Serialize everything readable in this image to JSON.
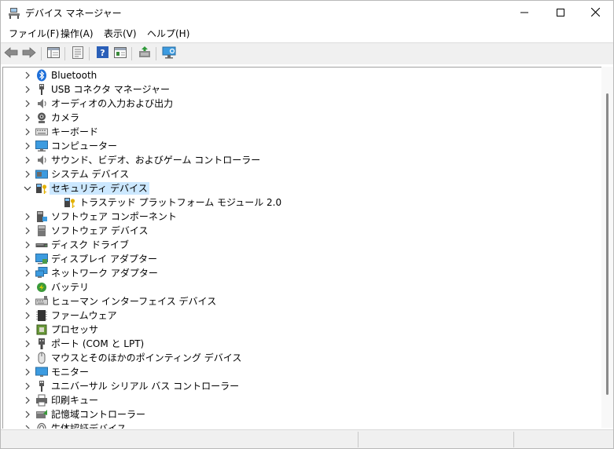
{
  "window": {
    "title": "デバイス マネージャー",
    "icons": {
      "app": "device-manager-icon",
      "minimize": "minimize-icon",
      "maximize": "maximize-icon",
      "close": "close-icon"
    }
  },
  "menu": [
    {
      "label": "ファイル(F)"
    },
    {
      "label": "操作(A)"
    },
    {
      "label": "表示(V)"
    },
    {
      "label": "ヘルプ(H)"
    }
  ],
  "toolbar": {
    "buttons": [
      "back-icon",
      "forward-icon",
      "properties-pane-icon",
      "properties-sheet-icon",
      "help-icon",
      "action-pane-icon",
      "update-driver-icon",
      "scan-hardware-icon"
    ]
  },
  "tree": {
    "items": [
      {
        "label": "Bluetooth",
        "icon": "bluetooth-icon",
        "expanded": false
      },
      {
        "label": "USB コネクタ マネージャー",
        "icon": "usb-connector-icon",
        "expanded": false
      },
      {
        "label": "オーディオの入力および出力",
        "icon": "speaker-icon",
        "expanded": false
      },
      {
        "label": "カメラ",
        "icon": "camera-icon",
        "expanded": false
      },
      {
        "label": "キーボード",
        "icon": "keyboard-icon",
        "expanded": false
      },
      {
        "label": "コンピューター",
        "icon": "computer-icon",
        "expanded": false
      },
      {
        "label": "サウンド、ビデオ、およびゲーム コントローラー",
        "icon": "sound-video-icon",
        "expanded": false
      },
      {
        "label": "システム デバイス",
        "icon": "system-device-icon",
        "expanded": false
      },
      {
        "label": "セキュリティ デバイス",
        "icon": "security-device-icon",
        "expanded": true,
        "selected": true
      },
      {
        "label": "トラステッド プラットフォーム モジュール 2.0",
        "icon": "tpm-icon",
        "child": true
      },
      {
        "label": "ソフトウェア コンポーネント",
        "icon": "software-component-icon",
        "expanded": false
      },
      {
        "label": "ソフトウェア デバイス",
        "icon": "software-device-icon",
        "expanded": false
      },
      {
        "label": "ディスク ドライブ",
        "icon": "disk-drive-icon",
        "expanded": false
      },
      {
        "label": "ディスプレイ アダプター",
        "icon": "display-adapter-icon",
        "expanded": false
      },
      {
        "label": "ネットワーク アダプター",
        "icon": "network-adapter-icon",
        "expanded": false
      },
      {
        "label": "バッテリ",
        "icon": "battery-icon",
        "expanded": false
      },
      {
        "label": "ヒューマン インターフェイス デバイス",
        "icon": "hid-icon",
        "expanded": false
      },
      {
        "label": "ファームウェア",
        "icon": "firmware-icon",
        "expanded": false
      },
      {
        "label": "プロセッサ",
        "icon": "processor-icon",
        "expanded": false
      },
      {
        "label": "ポート (COM と LPT)",
        "icon": "port-icon",
        "expanded": false
      },
      {
        "label": "マウスとそのほかのポインティング デバイス",
        "icon": "mouse-icon",
        "expanded": false
      },
      {
        "label": "モニター",
        "icon": "monitor-icon",
        "expanded": false
      },
      {
        "label": "ユニバーサル シリアル バス コントローラー",
        "icon": "usb-controller-icon",
        "expanded": false
      },
      {
        "label": "印刷キュー",
        "icon": "printer-icon",
        "expanded": false
      },
      {
        "label": "記憶域コントローラー",
        "icon": "storage-controller-icon",
        "expanded": false
      },
      {
        "label": "生体認証デバイス",
        "icon": "biometric-icon",
        "expanded": false
      }
    ]
  },
  "colors": {
    "selection": "#cce8ff",
    "bluetooth": "#1e6fd9",
    "monitor": "#3c9be0"
  }
}
